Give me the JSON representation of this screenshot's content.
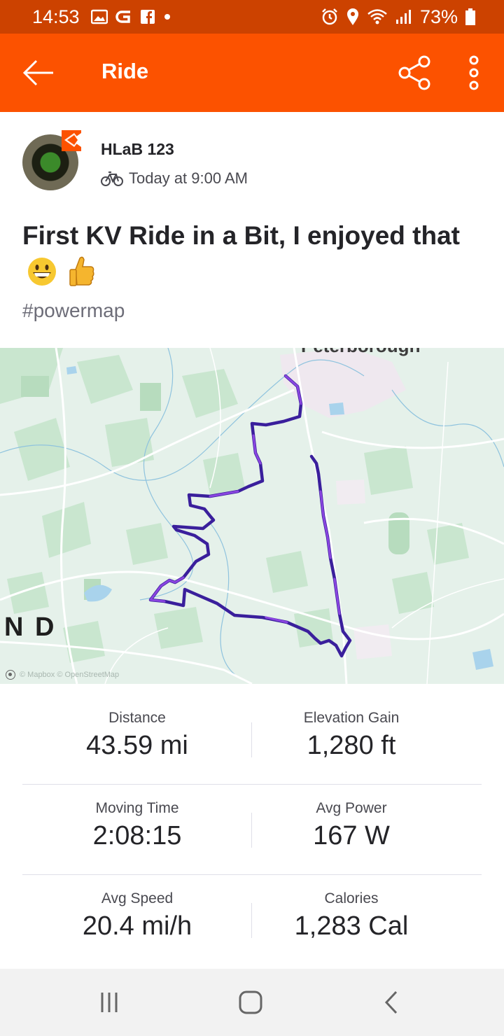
{
  "status_bar": {
    "time": "14:53",
    "battery": "73%"
  },
  "app_bar": {
    "title": "Ride"
  },
  "athlete": {
    "name": "HLaB 123",
    "activity_time": "Today at 9:00 AM"
  },
  "activity": {
    "title": "First KV Ride in a Bit, I enjoyed that",
    "hashtag": "#powermap"
  },
  "map": {
    "place_label_top": "Peterborough",
    "place_label_left": "N D",
    "attribution": "© Mapbox © OpenStreetMap",
    "route_color": "#4a2bb0"
  },
  "stats": [
    {
      "left": {
        "label": "Distance",
        "value": "43.59 mi"
      },
      "right": {
        "label": "Elevation Gain",
        "value": "1,280 ft"
      }
    },
    {
      "left": {
        "label": "Moving Time",
        "value": "2:08:15"
      },
      "right": {
        "label": "Avg Power",
        "value": "167 W"
      }
    },
    {
      "left": {
        "label": "Avg Speed",
        "value": "20.4 mi/h"
      },
      "right": {
        "label": "Calories",
        "value": "1,283 Cal"
      }
    }
  ],
  "colors": {
    "brand": "#fc5200",
    "status_bar": "#cc4200"
  }
}
